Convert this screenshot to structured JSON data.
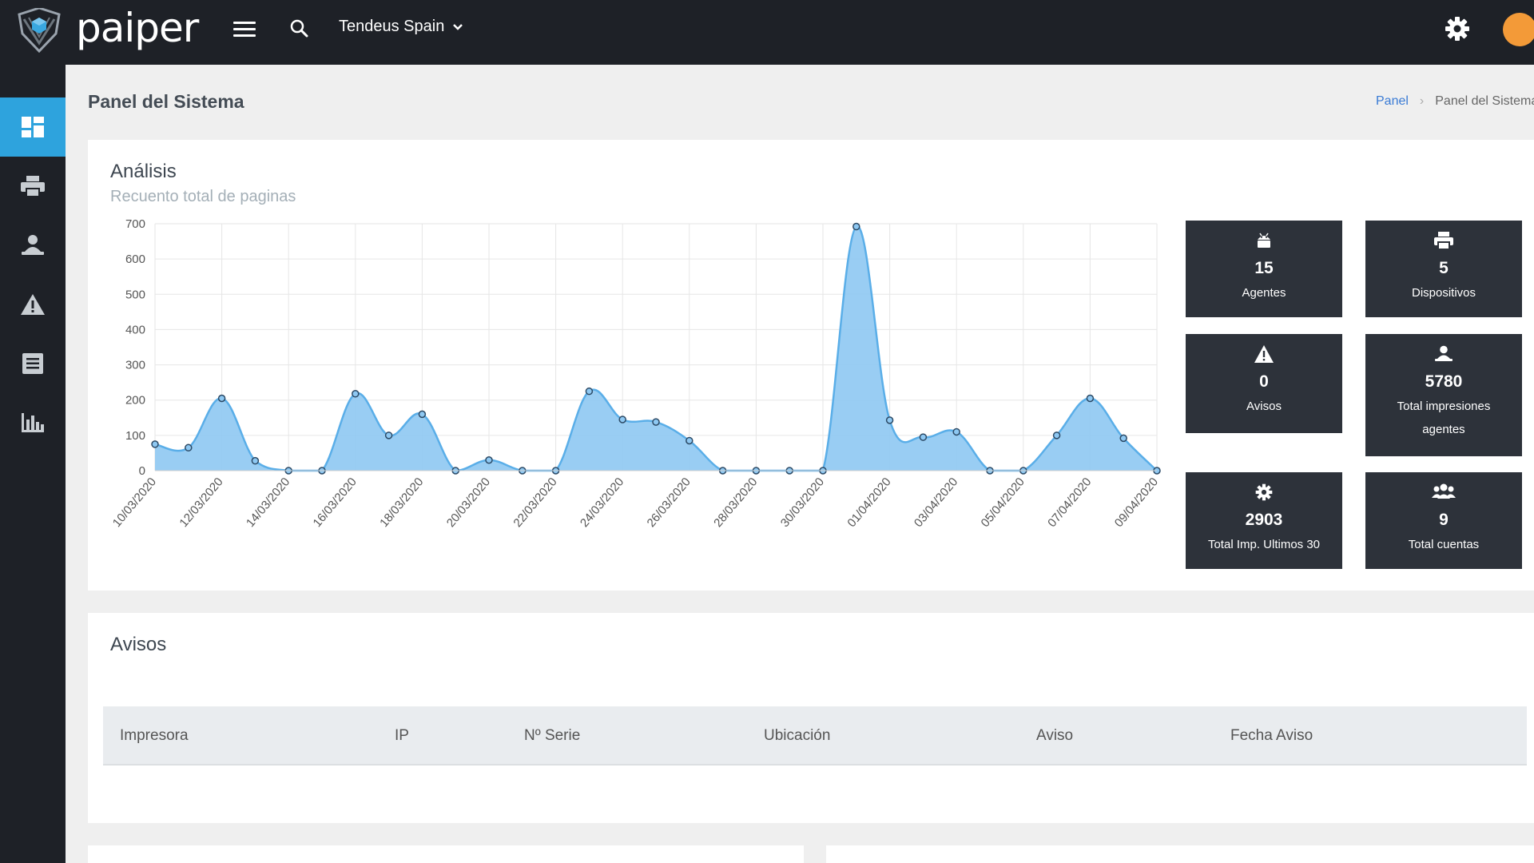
{
  "header": {
    "logo_text": "paiper",
    "company": "Tendeus Spain",
    "icons": [
      "menu-icon",
      "search-icon",
      "chevron-down-icon",
      "gear-icon"
    ]
  },
  "sidebar": {
    "items": [
      {
        "icon": "dashboard-icon",
        "active": true
      },
      {
        "icon": "printer-icon",
        "active": false
      },
      {
        "icon": "user-icon",
        "active": false
      },
      {
        "icon": "warning-icon",
        "active": false
      },
      {
        "icon": "list-icon",
        "active": false
      },
      {
        "icon": "bar-chart-icon",
        "active": false
      }
    ]
  },
  "page": {
    "title": "Panel del Sistema",
    "breadcrumb": {
      "home": "Panel",
      "current": "Panel del Sistema"
    }
  },
  "analysis": {
    "title": "Análisis",
    "subtitle": "Recuento total de paginas"
  },
  "chart_data": {
    "type": "area",
    "x": [
      "10/03/2020",
      "11/03/2020",
      "12/03/2020",
      "13/03/2020",
      "14/03/2020",
      "15/03/2020",
      "16/03/2020",
      "17/03/2020",
      "18/03/2020",
      "19/03/2020",
      "20/03/2020",
      "21/03/2020",
      "22/03/2020",
      "23/03/2020",
      "24/03/2020",
      "25/03/2020",
      "26/03/2020",
      "27/03/2020",
      "28/03/2020",
      "29/03/2020",
      "30/03/2020",
      "31/03/2020",
      "01/04/2020",
      "02/04/2020",
      "03/04/2020",
      "04/04/2020",
      "05/04/2020",
      "06/04/2020",
      "07/04/2020",
      "08/04/2020",
      "09/04/2020"
    ],
    "values": [
      75,
      65,
      205,
      28,
      0,
      0,
      218,
      100,
      160,
      0,
      30,
      0,
      0,
      225,
      145,
      138,
      85,
      0,
      0,
      0,
      0,
      692,
      143,
      95,
      110,
      0,
      0,
      100,
      205,
      92,
      0
    ],
    "x_tick_labels": [
      "10/03/2020",
      "12/03/2020",
      "14/03/2020",
      "16/03/2020",
      "18/03/2020",
      "20/03/2020",
      "22/03/2020",
      "24/03/2020",
      "26/03/2020",
      "28/03/2020",
      "30/03/2020",
      "01/04/2020",
      "03/04/2020",
      "05/04/2020",
      "07/04/2020",
      "09/04/2020"
    ],
    "y_ticks": [
      0,
      100,
      200,
      300,
      400,
      500,
      600,
      700
    ],
    "ylim": [
      0,
      700
    ],
    "grid": true,
    "colors": {
      "fill": "#8ec8f2",
      "line": "#5aaee8",
      "point_stroke": "#2c4a66",
      "point_fill": "#8ec8f2"
    }
  },
  "stats": [
    {
      "icon": "android-icon",
      "value": "15",
      "label": "Agentes"
    },
    {
      "icon": "printer-icon",
      "value": "5",
      "label": "Dispositivos"
    },
    {
      "icon": "warning-icon",
      "value": "0",
      "label": "Avisos"
    },
    {
      "icon": "user-icon",
      "value": "5780",
      "label": "Total impresiones agentes"
    },
    {
      "icon": "gear-icon",
      "value": "2903",
      "label": "Total Imp. Ultimos 30"
    },
    {
      "icon": "users-icon",
      "value": "9",
      "label": "Total cuentas"
    }
  ],
  "avisos": {
    "title": "Avisos",
    "columns": [
      "Impresora",
      "IP",
      "Nº Serie",
      "Ubicación",
      "Aviso",
      "Fecha Aviso"
    ]
  },
  "colors": {
    "topbar": "#1e2127",
    "accent": "#2ea3dd",
    "stat_bg": "#2d323a",
    "avatar": "#f39a38"
  }
}
